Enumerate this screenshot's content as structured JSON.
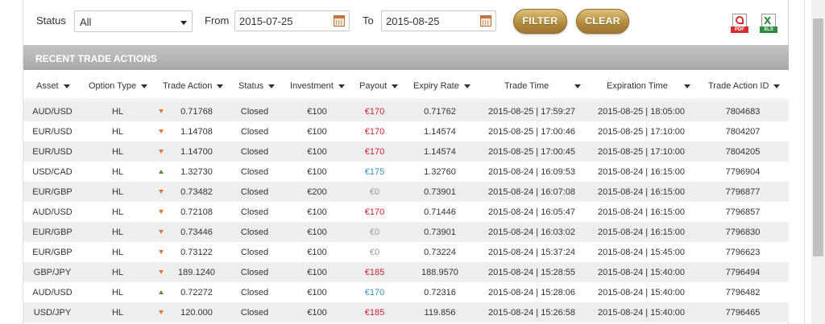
{
  "filters": {
    "status_label": "Status",
    "status_value": "All",
    "from_label": "From",
    "from_value": "2015-07-25",
    "to_label": "To",
    "to_value": "2015-08-25",
    "filter_button": "FILTER",
    "clear_button": "CLEAR",
    "pdf_tag": "PDF",
    "xls_tag": "XLS"
  },
  "panel": {
    "title": "RECENT TRADE ACTIONS"
  },
  "columns": [
    "Asset",
    "Option Type",
    "Trade Action",
    "Status",
    "Investment",
    "Payout",
    "Expiry Rate",
    "Trade Time",
    "Expiration Time",
    "Trade Action ID"
  ],
  "colors": {
    "payout_loss": "#cc2233",
    "payout_win": "#3a8fbf",
    "payout_zero": "#999999",
    "arrow_down": "#e8742b",
    "arrow_up": "#5d8a3c",
    "gold_button": "#b0893c"
  },
  "rows": [
    {
      "asset": "AUD/USD",
      "type": "HL",
      "dir": "down",
      "action": "0.71768",
      "status": "Closed",
      "investment": "€100",
      "payout": "€170",
      "payout_kind": "loss",
      "expiry": "0.71762",
      "trade_time": "2015-08-25 | 17:59:27",
      "expiration_time": "2015-08-25 | 18:05:00",
      "id": "7804683"
    },
    {
      "asset": "EUR/USD",
      "type": "HL",
      "dir": "down",
      "action": "1.14708",
      "status": "Closed",
      "investment": "€100",
      "payout": "€170",
      "payout_kind": "loss",
      "expiry": "1.14574",
      "trade_time": "2015-08-25 | 17:00:46",
      "expiration_time": "2015-08-25 | 17:10:00",
      "id": "7804207"
    },
    {
      "asset": "EUR/USD",
      "type": "HL",
      "dir": "down",
      "action": "1.14700",
      "status": "Closed",
      "investment": "€100",
      "payout": "€170",
      "payout_kind": "loss",
      "expiry": "1.14574",
      "trade_time": "2015-08-25 | 17:00:45",
      "expiration_time": "2015-08-25 | 17:10:00",
      "id": "7804205"
    },
    {
      "asset": "USD/CAD",
      "type": "HL",
      "dir": "up",
      "action": "1.32730",
      "status": "Closed",
      "investment": "€100",
      "payout": "€175",
      "payout_kind": "win",
      "expiry": "1.32760",
      "trade_time": "2015-08-24 | 16:09:53",
      "expiration_time": "2015-08-24 | 16:15:00",
      "id": "7796904"
    },
    {
      "asset": "EUR/GBP",
      "type": "HL",
      "dir": "down",
      "action": "0.73482",
      "status": "Closed",
      "investment": "€200",
      "payout": "€0",
      "payout_kind": "zero",
      "expiry": "0.73901",
      "trade_time": "2015-08-24 | 16:07:08",
      "expiration_time": "2015-08-24 | 16:15:00",
      "id": "7796877"
    },
    {
      "asset": "AUD/USD",
      "type": "HL",
      "dir": "down",
      "action": "0.72108",
      "status": "Closed",
      "investment": "€100",
      "payout": "€170",
      "payout_kind": "loss",
      "expiry": "0.71446",
      "trade_time": "2015-08-24 | 16:05:47",
      "expiration_time": "2015-08-24 | 16:15:00",
      "id": "7796857"
    },
    {
      "asset": "EUR/GBP",
      "type": "HL",
      "dir": "down",
      "action": "0.73446",
      "status": "Closed",
      "investment": "€100",
      "payout": "€0",
      "payout_kind": "zero",
      "expiry": "0.73901",
      "trade_time": "2015-08-24 | 16:03:02",
      "expiration_time": "2015-08-24 | 16:15:00",
      "id": "7796830"
    },
    {
      "asset": "EUR/GBP",
      "type": "HL",
      "dir": "down",
      "action": "0.73122",
      "status": "Closed",
      "investment": "€100",
      "payout": "€0",
      "payout_kind": "zero",
      "expiry": "0.73224",
      "trade_time": "2015-08-24 | 15:37:24",
      "expiration_time": "2015-08-24 | 15:45:00",
      "id": "7796623"
    },
    {
      "asset": "GBP/JPY",
      "type": "HL",
      "dir": "down",
      "action": "189.1240",
      "status": "Closed",
      "investment": "€100",
      "payout": "€185",
      "payout_kind": "loss",
      "expiry": "188.9570",
      "trade_time": "2015-08-24 | 15:28:55",
      "expiration_time": "2015-08-24 | 15:40:00",
      "id": "7796494"
    },
    {
      "asset": "AUD/USD",
      "type": "HL",
      "dir": "up",
      "action": "0.72272",
      "status": "Closed",
      "investment": "€100",
      "payout": "€170",
      "payout_kind": "win",
      "expiry": "0.72316",
      "trade_time": "2015-08-24 | 15:28:06",
      "expiration_time": "2015-08-24 | 15:40:00",
      "id": "7796482"
    },
    {
      "asset": "USD/JPY",
      "type": "HL",
      "dir": "down",
      "action": "120.000",
      "status": "Closed",
      "investment": "€100",
      "payout": "€185",
      "payout_kind": "loss",
      "expiry": "119.856",
      "trade_time": "2015-08-24 | 15:26:58",
      "expiration_time": "2015-08-24 | 15:40:00",
      "id": "7796465"
    }
  ]
}
